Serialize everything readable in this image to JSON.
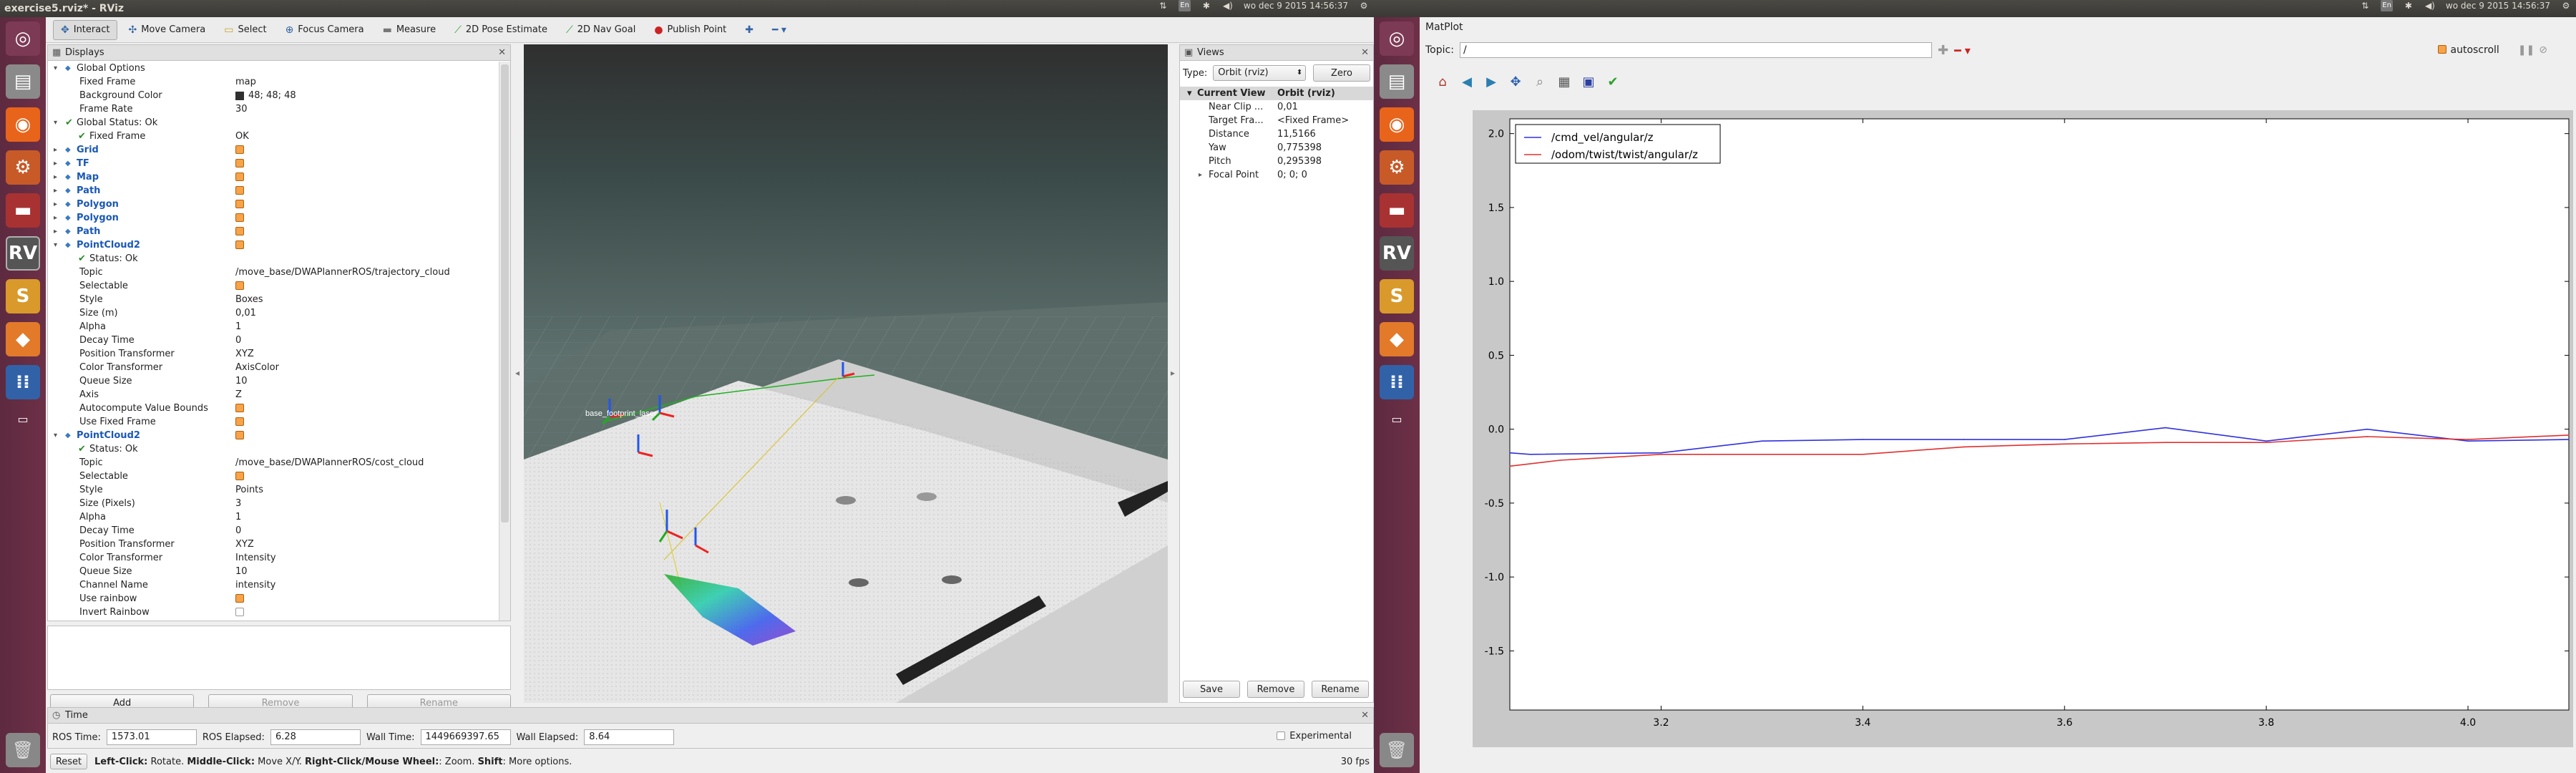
{
  "left_screen": {
    "window_title": "exercise5.rviz* - RViz",
    "clock": "wo dec  9 2015 14:56:37",
    "toolbar": [
      "Interact",
      "Move Camera",
      "Select",
      "Focus Camera",
      "Measure",
      "2D Pose Estimate",
      "2D Nav Goal",
      "Publish Point"
    ],
    "displays_title": "Displays",
    "display_rows": [
      {
        "indent": 1,
        "key": "Global Options",
        "val": "",
        "blue": false
      },
      {
        "indent": 2,
        "key": "Fixed Frame",
        "val": "map"
      },
      {
        "indent": 2,
        "key": "Background Color",
        "val": "48; 48; 48",
        "swatch": "#303030"
      },
      {
        "indent": 2,
        "key": "Frame Rate",
        "val": "30"
      },
      {
        "indent": 1,
        "key": "Global Status: Ok",
        "val": "",
        "check": true
      },
      {
        "indent": 2,
        "key": "Fixed Frame",
        "val": "OK",
        "check": true
      },
      {
        "indent": 1,
        "key": "Grid",
        "val": "",
        "blue": true,
        "box": true
      },
      {
        "indent": 1,
        "key": "TF",
        "val": "",
        "blue": true,
        "box": true
      },
      {
        "indent": 1,
        "key": "Map",
        "val": "",
        "blue": true,
        "box": true
      },
      {
        "indent": 1,
        "key": "Path",
        "val": "",
        "blue": true,
        "box": true
      },
      {
        "indent": 1,
        "key": "Polygon",
        "val": "",
        "blue": true,
        "box": true
      },
      {
        "indent": 1,
        "key": "Polygon",
        "val": "",
        "blue": true,
        "box": true
      },
      {
        "indent": 1,
        "key": "Path",
        "val": "",
        "blue": true,
        "box": true
      },
      {
        "indent": 1,
        "key": "PointCloud2",
        "val": "",
        "blue": true,
        "box": true
      },
      {
        "indent": 2,
        "key": "Status: Ok",
        "val": "",
        "check": true
      },
      {
        "indent": 2,
        "key": "Topic",
        "val": "/move_base/DWAPlannerROS/trajectory_cloud"
      },
      {
        "indent": 2,
        "key": "Selectable",
        "val": "",
        "box": true
      },
      {
        "indent": 2,
        "key": "Style",
        "val": "Boxes"
      },
      {
        "indent": 2,
        "key": "Size (m)",
        "val": "0,01"
      },
      {
        "indent": 2,
        "key": "Alpha",
        "val": "1"
      },
      {
        "indent": 2,
        "key": "Decay Time",
        "val": "0"
      },
      {
        "indent": 2,
        "key": "Position Transformer",
        "val": "XYZ"
      },
      {
        "indent": 2,
        "key": "Color Transformer",
        "val": "AxisColor"
      },
      {
        "indent": 2,
        "key": "Queue Size",
        "val": "10"
      },
      {
        "indent": 2,
        "key": "Axis",
        "val": "Z"
      },
      {
        "indent": 2,
        "key": "Autocompute Value Bounds",
        "val": "",
        "box": true
      },
      {
        "indent": 2,
        "key": "Use Fixed Frame",
        "val": "",
        "box": true
      },
      {
        "indent": 1,
        "key": "PointCloud2",
        "val": "",
        "blue": true,
        "box": true
      },
      {
        "indent": 2,
        "key": "Status: Ok",
        "val": "",
        "check": true
      },
      {
        "indent": 2,
        "key": "Topic",
        "val": "/move_base/DWAPlannerROS/cost_cloud"
      },
      {
        "indent": 2,
        "key": "Selectable",
        "val": "",
        "box": true
      },
      {
        "indent": 2,
        "key": "Style",
        "val": "Points"
      },
      {
        "indent": 2,
        "key": "Size (Pixels)",
        "val": "3"
      },
      {
        "indent": 2,
        "key": "Alpha",
        "val": "1"
      },
      {
        "indent": 2,
        "key": "Decay Time",
        "val": "0"
      },
      {
        "indent": 2,
        "key": "Position Transformer",
        "val": "XYZ"
      },
      {
        "indent": 2,
        "key": "Color Transformer",
        "val": "Intensity"
      },
      {
        "indent": 2,
        "key": "Queue Size",
        "val": "10"
      },
      {
        "indent": 2,
        "key": "Channel Name",
        "val": "intensity"
      },
      {
        "indent": 2,
        "key": "Use rainbow",
        "val": "",
        "box": true
      },
      {
        "indent": 2,
        "key": "Invert Rainbow",
        "val": "",
        "box": true,
        "off": true
      }
    ],
    "display_buttons": [
      "Add",
      "Remove",
      "Rename"
    ],
    "views_title": "Views",
    "views_type_label": "Type:",
    "views_type_value": "Orbit (rviz)",
    "views_zero": "Zero",
    "views_header": {
      "key": "Current View",
      "val": "Orbit (rviz)"
    },
    "views_rows": [
      {
        "key": "Near Clip ...",
        "val": "0,01"
      },
      {
        "key": "Target Fra...",
        "val": "<Fixed Frame>"
      },
      {
        "key": "Distance",
        "val": "11,5166"
      },
      {
        "key": "Yaw",
        "val": "0,775398"
      },
      {
        "key": "Pitch",
        "val": "0,295398"
      },
      {
        "key": "Focal Point",
        "val": "0; 0; 0"
      }
    ],
    "views_buttons": [
      "Save",
      "Remove",
      "Rename"
    ],
    "view3d_label": "base_footprint_laser",
    "time_title": "Time",
    "ros_time_label": "ROS Time:",
    "ros_time": "1573.01",
    "ros_elapsed_label": "ROS Elapsed:",
    "ros_elapsed": "6.28",
    "wall_time_label": "Wall Time:",
    "wall_time": "1449669397.65",
    "wall_elapsed_label": "Wall Elapsed:",
    "wall_elapsed": "8.64",
    "experimental": "Experimental",
    "reset": "Reset",
    "status_help_bold1": "Left-Click:",
    "status_help1": " Rotate. ",
    "status_help_bold2": "Middle-Click:",
    "status_help2": " Move X/Y. ",
    "status_help_bold3": "Right-Click/Mouse Wheel:",
    "status_help3": ": Zoom. ",
    "status_help_bold4": "Shift",
    "status_help4": ": More options.",
    "fps": "30 fps"
  },
  "right_screen": {
    "clock": "wo dec  9 2015 14:56:37",
    "window_title": "MatPlot",
    "topic_label": "Topic:",
    "topic_value": "/",
    "autoscroll": "autoscroll"
  },
  "chart_data": {
    "type": "line",
    "title": "",
    "xlabel": "",
    "ylabel": "",
    "xlim": [
      3.05,
      4.1
    ],
    "ylim": [
      -1.9,
      2.1
    ],
    "xticks": [
      3.2,
      3.4,
      3.6,
      3.8,
      4.0
    ],
    "xtick_labels": [
      "3.2",
      "3.4",
      "3.6",
      "3.8",
      "4.0"
    ],
    "yticks": [
      2.0,
      1.5,
      1.0,
      0.5,
      0.0,
      -0.5,
      -1.0,
      -1.5
    ],
    "ytick_labels": [
      "2.0",
      "1.5",
      "1.0",
      "0.5",
      "0.0",
      "-0.5",
      "-1.0",
      "-1.5"
    ],
    "legend": "top-left",
    "series": [
      {
        "name": "/cmd_vel/angular/z",
        "color": "#3030e0",
        "x": [
          3.05,
          3.07,
          3.2,
          3.3,
          3.4,
          3.5,
          3.6,
          3.7,
          3.8,
          3.9,
          4.0,
          4.1
        ],
        "y": [
          -0.16,
          -0.17,
          -0.16,
          -0.08,
          -0.07,
          -0.07,
          -0.07,
          0.01,
          -0.08,
          0.0,
          -0.08,
          -0.07
        ]
      },
      {
        "name": "/odom/twist/twist/angular/z",
        "color": "#e03030",
        "x": [
          3.05,
          3.1,
          3.2,
          3.3,
          3.4,
          3.5,
          3.6,
          3.7,
          3.8,
          3.9,
          4.0,
          4.1
        ],
        "y": [
          -0.25,
          -0.21,
          -0.17,
          -0.17,
          -0.17,
          -0.12,
          -0.1,
          -0.09,
          -0.09,
          -0.05,
          -0.07,
          -0.04
        ]
      }
    ]
  }
}
